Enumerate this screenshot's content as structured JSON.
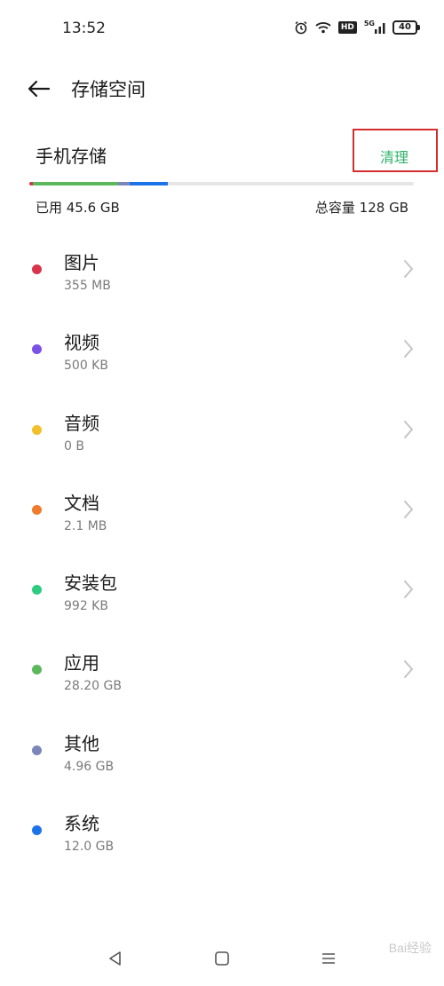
{
  "status_bar": {
    "time": "13:52",
    "battery": "40",
    "hd_label": "HD",
    "network_label": "5G"
  },
  "header": {
    "title": "存储空间"
  },
  "storage": {
    "section_title": "手机存储",
    "clean_label": "清理",
    "used_label": "已用 45.6  GB",
    "total_label": "总容量 128 GB",
    "used_fraction": 0.356,
    "bar_segments": [
      {
        "name": "图片",
        "color": "#d9344a",
        "fraction": 0.01
      },
      {
        "name": "应用",
        "color": "#5cb85c",
        "fraction": 0.22
      },
      {
        "name": "其他",
        "color": "#7a87b8",
        "fraction": 0.03
      },
      {
        "name": "系统",
        "color": "#1a73e8",
        "fraction": 0.1
      }
    ]
  },
  "categories": [
    {
      "name": "图片",
      "size": "355 MB",
      "color": "#d9344a",
      "has_chevron": true
    },
    {
      "name": "视频",
      "size": "500 KB",
      "color": "#7b52e6",
      "has_chevron": true
    },
    {
      "name": "音频",
      "size": "0 B",
      "color": "#f2c029",
      "has_chevron": true
    },
    {
      "name": "文档",
      "size": "2.1 MB",
      "color": "#f07a2e",
      "has_chevron": true
    },
    {
      "name": "安装包",
      "size": "992 KB",
      "color": "#2ecc80",
      "has_chevron": true
    },
    {
      "name": "应用",
      "size": "28.20  GB",
      "color": "#5cb85c",
      "has_chevron": true
    },
    {
      "name": "其他",
      "size": "4.96 GB",
      "color": "#7a87b8",
      "has_chevron": false
    },
    {
      "name": "系统",
      "size": "12.0 GB",
      "color": "#1a73e8",
      "has_chevron": false
    }
  ],
  "nav": {
    "back": "back-triangle",
    "home": "home-square",
    "menu": "menu-lines"
  },
  "watermark": "Bai经验"
}
